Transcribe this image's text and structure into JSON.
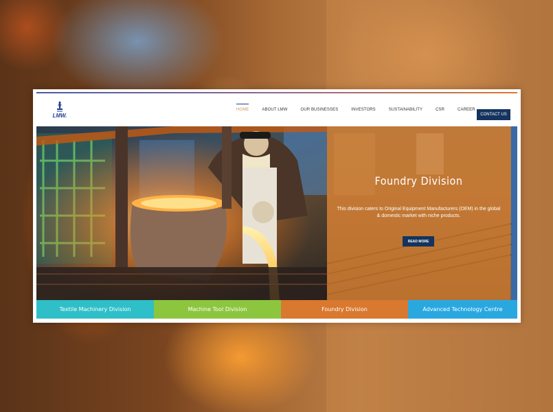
{
  "brand": {
    "logo_text": "LMW.",
    "accent": "#1f3f8f"
  },
  "nav": {
    "items": [
      {
        "label": "HOME",
        "active": true
      },
      {
        "label": "ABOUT LMW"
      },
      {
        "label": "OUR BUSINESSES"
      },
      {
        "label": "INVESTORS"
      },
      {
        "label": "SUSTAINABILITY"
      },
      {
        "label": "CSR"
      },
      {
        "label": "CAREER"
      }
    ],
    "contact_label": "CONTACT US",
    "active_color": "#c99a55"
  },
  "hero": {
    "title": "Foundry Division",
    "description": "This division caters to Original Equipment Manufacturers (OEM) in the global & domestic market with niche products.",
    "button_label": "READ MORE",
    "button_color": "#14345e",
    "overlay_color": "#cd782d"
  },
  "divisions": [
    {
      "label": "Textile Machinery Division",
      "color": "#2fbfc8"
    },
    {
      "label": "Machine Tool Division",
      "color": "#8cc63f"
    },
    {
      "label": "Foundry Division",
      "color": "#d9782f"
    },
    {
      "label": "Advanced Technology Centre",
      "color": "#29a8e0"
    }
  ]
}
